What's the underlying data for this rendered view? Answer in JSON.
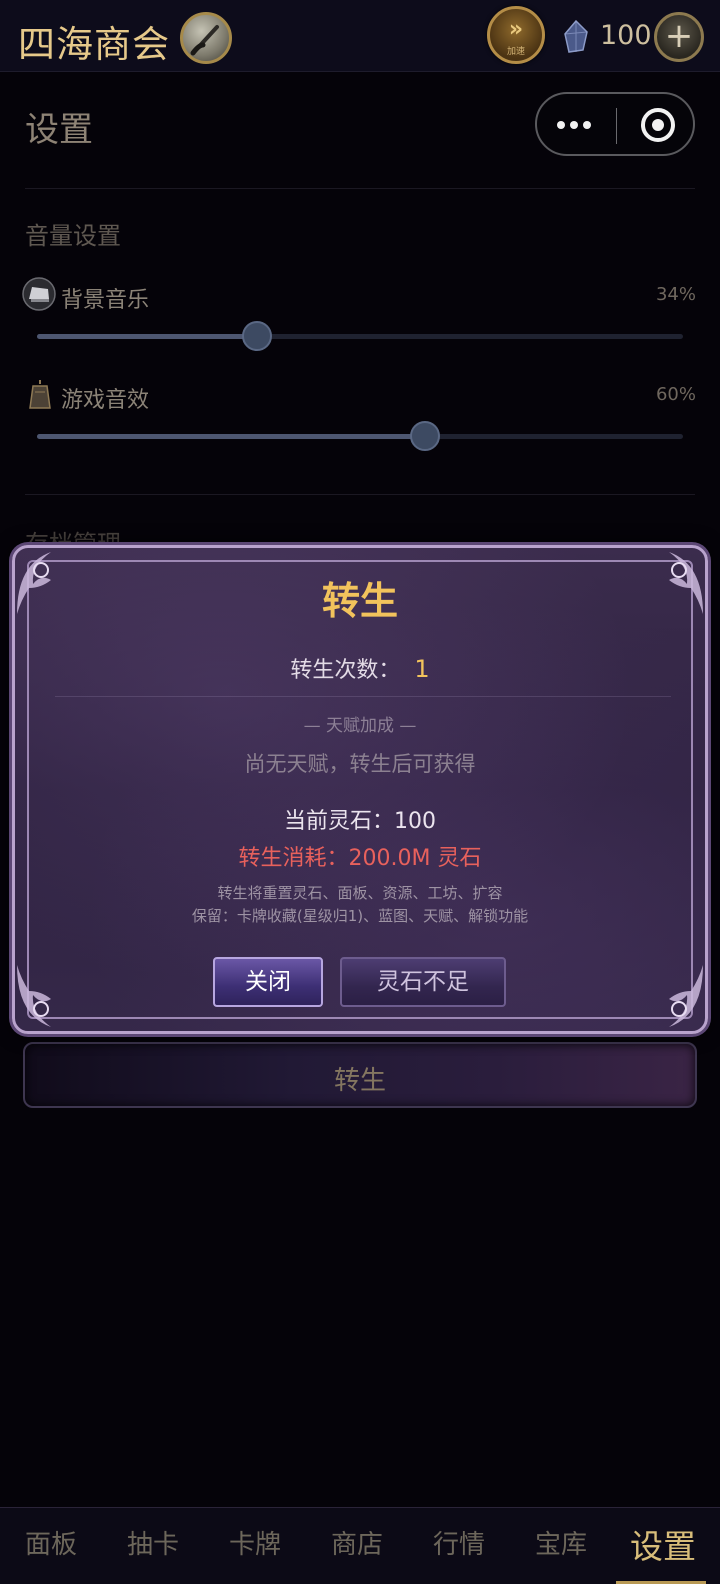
{
  "header": {
    "app_title": "四海商会",
    "speed_label": "加速",
    "gem_count": "100",
    "plus_symbol": "+"
  },
  "page": {
    "title": "设置",
    "capsule": {
      "more": "more-dots",
      "close": "target-circle"
    }
  },
  "volume": {
    "section_title": "音量设置",
    "bgm": {
      "label": "背景音乐",
      "percent_text": "34%",
      "value": 0.34
    },
    "sfx": {
      "label": "游戏音效",
      "percent_text": "60%",
      "value": 0.6
    }
  },
  "save_section": {
    "title_partial": "存档管理"
  },
  "rebirth_button": {
    "label": "转生"
  },
  "modal": {
    "title": "转生",
    "count_label": "转生次数：",
    "count_value": "1",
    "talent_header": "— 天赋加成 —",
    "talent_empty": "尚无天赋，转生后可获得",
    "current_stones": "当前灵石：100",
    "cost": "转生消耗：200.0M 灵石",
    "note_reset": "转生将重置灵石、面板、资源、工坊、扩容",
    "note_keep": "保留：卡牌收藏(星级归1)、蓝图、天赋、解锁功能",
    "close_label": "关闭",
    "insufficient_label": "灵石不足"
  },
  "nav": {
    "items": [
      "面板",
      "抽卡",
      "卡牌",
      "商店",
      "行情",
      "宝库",
      "设置"
    ],
    "active_index": 6
  },
  "colors": {
    "gold": "#f2c35c",
    "cost_red": "#e8615c",
    "background": "#050309"
  }
}
